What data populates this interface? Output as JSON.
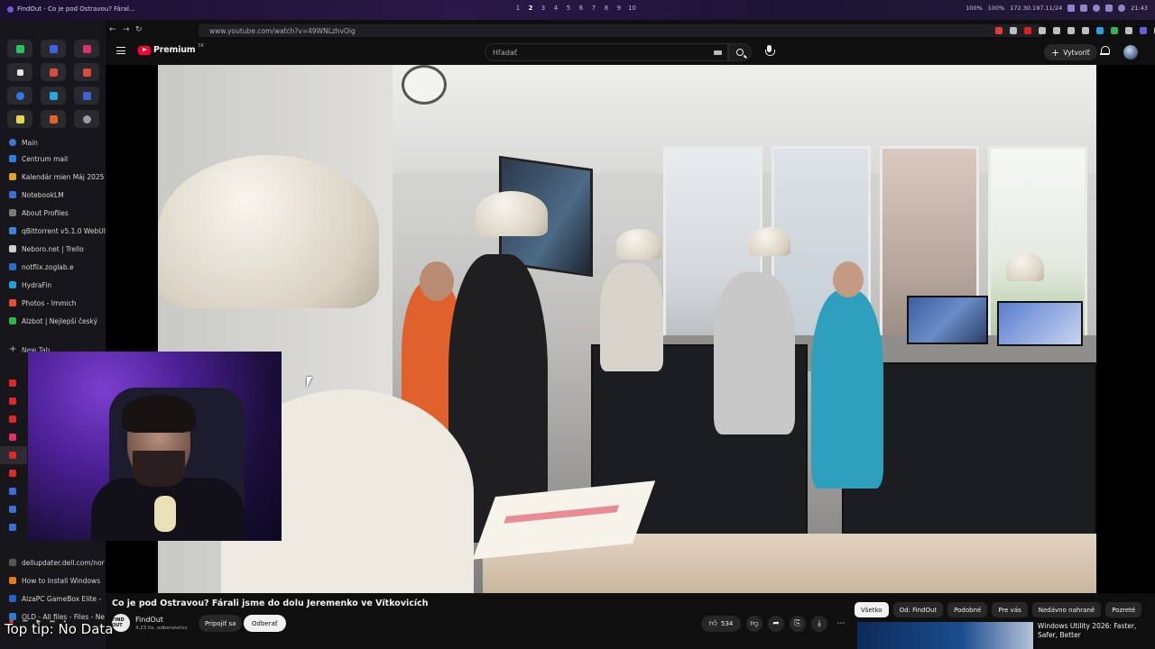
{
  "os": {
    "window_title": "FindOut - Co je pod Ostravou? Fáral...",
    "workspaces": [
      "1",
      "2",
      "3",
      "4",
      "5",
      "6",
      "7",
      "8",
      "9",
      "10"
    ],
    "active_workspace": "2",
    "volume": "100%",
    "battery": "100%",
    "ip": "172.30.197.11/24",
    "clock": "21:43"
  },
  "browser": {
    "url": "www.youtube.com/watch?v=49WNLzhvOig"
  },
  "sidebar": {
    "section_main": "Main",
    "items": [
      {
        "label": "Centrum mail",
        "color": "#2f7de1"
      },
      {
        "label": "Kalendár mien Máj 2025",
        "color": "#e0a030"
      },
      {
        "label": "NotebookLM",
        "color": "#3a6fd8"
      },
      {
        "label": "About Profiles",
        "color": "#7a7a7a"
      },
      {
        "label": "qBittorrent v5.1.0 WebUI",
        "color": "#3c84d6"
      },
      {
        "label": "Neboro.net | Trello",
        "color": "#cfcfcf"
      },
      {
        "label": "notflix.zoglab.e",
        "color": "#2d69c8"
      },
      {
        "label": "HydraFin",
        "color": "#1fa3d2"
      },
      {
        "label": "Photos - Immich",
        "color": "#e2503a"
      },
      {
        "label": "Alzbot | Nejlepší český",
        "color": "#2fb34a"
      }
    ],
    "new_tab_label": "New Tab",
    "bottom_items": [
      {
        "label": "dellupdater.dell.com/nor",
        "color": "#555555"
      },
      {
        "label": "How to Install Windows",
        "color": "#e07b1f"
      },
      {
        "label": "AlzaPC GameBox Elite -",
        "color": "#2a60c8"
      },
      {
        "label": "OLD - All files - Files - Ne",
        "color": "#2a7cd8"
      }
    ]
  },
  "youtube": {
    "brand": "Premium",
    "brand_sup": "SK",
    "search_placeholder": "Hľadať",
    "create_label": "Vytvoriť"
  },
  "video": {
    "title": "Co je pod Ostravou? Fárali jsme do dolu Jeremenko ve Vítkovicích",
    "channel": "FindOut",
    "channel_avatar_text": "FIND OUT",
    "subscribers": "4,23 tis. odberateľov",
    "join_label": "Pripojiť sa",
    "subscribe_label": "Odberať",
    "likes": "534"
  },
  "chips": [
    {
      "label": "Všetko",
      "active": true
    },
    {
      "label": "Od: FindOut",
      "active": false
    },
    {
      "label": "Podobné",
      "active": false
    },
    {
      "label": "Pre vás",
      "active": false
    },
    {
      "label": "Nedávno nahrané",
      "active": false
    },
    {
      "label": "Pozreté",
      "active": false
    }
  ],
  "recommendation": {
    "title": "Windows Utility 2026: Faster, Safer, Better"
  },
  "overlay": {
    "tip": "Top tip: No Data"
  },
  "colors": {
    "youtube_red": "#ff0033",
    "background": "#0f0f0f"
  }
}
